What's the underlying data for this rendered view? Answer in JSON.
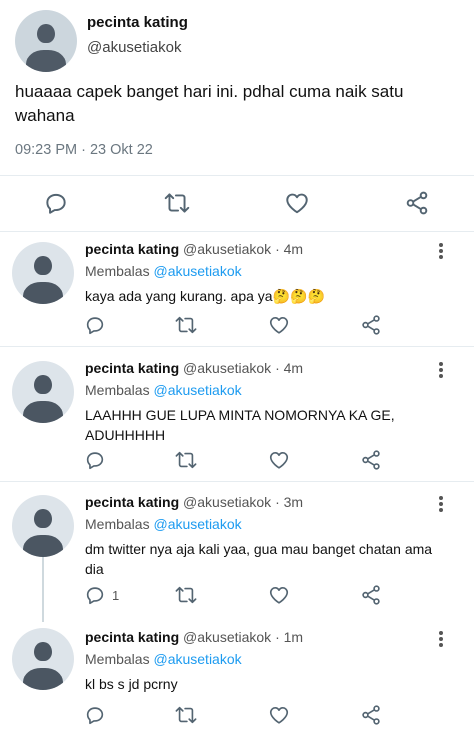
{
  "main_tweet": {
    "display_name": "pecinta kating",
    "handle": "@akusetiakok",
    "text": "huaaaa capek banget hari ini. pdhal cuma naik satu wahana",
    "meta": "09:23 PM · 23 Okt 22",
    "icons": {
      "reply": "reply-icon",
      "retweet": "retweet-icon",
      "like": "heart-icon",
      "share": "share-icon"
    }
  },
  "replies": [
    {
      "display_name": "pecinta kating",
      "handle": "@akusetiakok",
      "dot": "·",
      "time": "4m",
      "replying_prefix": "Membalas",
      "replying_to": "@akusetiakok",
      "text": "kaya ada yang kurang. apa ya🤔🤔🤔",
      "reply_count": ""
    },
    {
      "display_name": "pecinta kating",
      "handle": "@akusetiakok",
      "dot": "·",
      "time": "4m",
      "replying_prefix": "Membalas",
      "replying_to": "@akusetiakok",
      "text": "LAAHHH GUE LUPA MINTA NOMORNYA KA GE, ADUHHHHH",
      "reply_count": ""
    },
    {
      "display_name": "pecinta kating",
      "handle": "@akusetiakok",
      "dot": "·",
      "time": "3m",
      "replying_prefix": "Membalas",
      "replying_to": "@akusetiakok",
      "text": "dm twitter nya aja kali yaa, gua mau banget chatan ama dia",
      "reply_count": "1"
    },
    {
      "display_name": "pecinta kating",
      "handle": "@akusetiakok",
      "dot": "·",
      "time": "1m",
      "replying_prefix": "Membalas",
      "replying_to": "@akusetiakok",
      "text": "kl bs s jd pcrny",
      "reply_count": ""
    }
  ],
  "colors": {
    "mention": "#1d9bf0",
    "icon": "#536471",
    "divider": "#e6ecf0"
  }
}
